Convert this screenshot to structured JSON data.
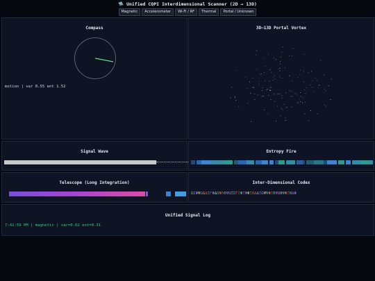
{
  "header": {
    "title": "🛸 Unified CQPI Interdimensional Scanner (2D → 13D)",
    "tabs": [
      "Magnetic",
      "Accelerometer",
      "Wi-Fi / RF",
      "Thermal",
      "Portal / Unknown"
    ]
  },
  "compass": {
    "title": "Compass",
    "readout": "motion | var 0.55 ent 1.52",
    "needle_color": "#5fe07a"
  },
  "vortex": {
    "title": "3D–13D Portal Vortex"
  },
  "signal_wave": {
    "title": "Signal Wave"
  },
  "entropy_fire": {
    "title": "Entropy Fire"
  },
  "telescope": {
    "title": "Telescope (Long Integration)"
  },
  "codex": {
    "title": "Inter-Dimensional Codex",
    "glyphs": "ΩΣΦΨΩΔΔΞΓΦΔΩΨΛΘΨΩΞΣΓΞΦΞΨΦΞΛΔΔΞΩΨΨΦΞΘΨΩΘΨΦΞΘΔΦ"
  },
  "log": {
    "title": "Unified Signal Log",
    "entry": "7:42:59 PM | magnetic | var=0.62 ent=0.31"
  },
  "colors": {
    "background": "#06080f",
    "panel": "#0e1424",
    "log_text": "#2fd06a"
  }
}
